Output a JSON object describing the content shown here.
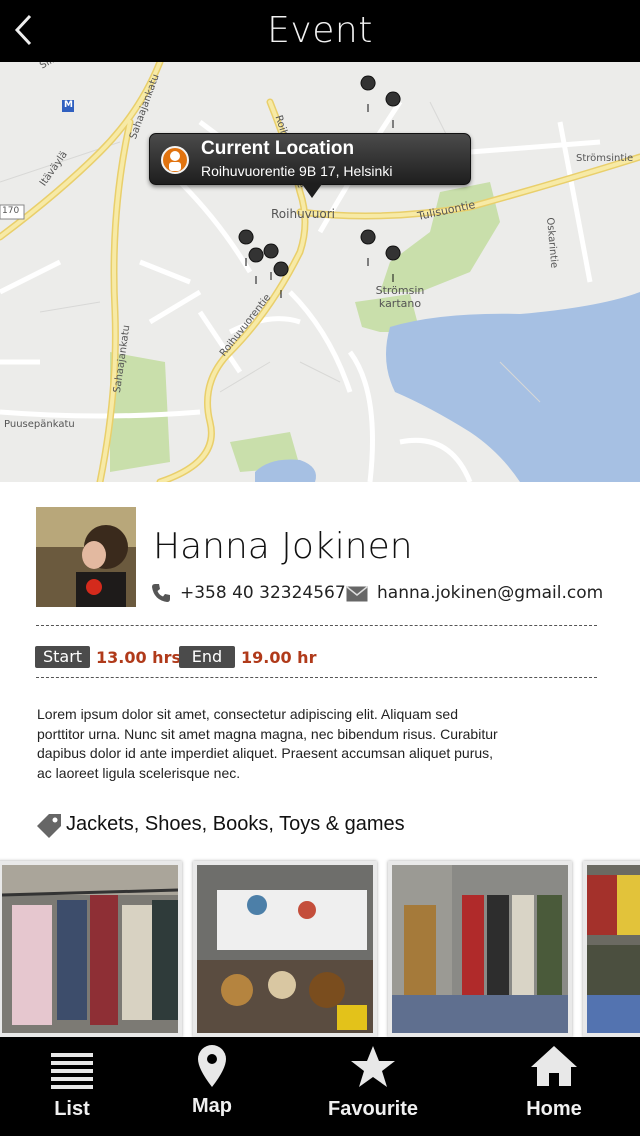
{
  "header": {
    "title": "Event",
    "back_icon": "chevron-left-icon"
  },
  "map": {
    "callout": {
      "title": "Current Location",
      "address": "Roihuvuorentie 9B 17, Helsinki",
      "icon": "person-icon"
    },
    "street_labels": [
      "Sahaajankatu",
      "Itäväylä",
      "Roihuvuorentie",
      "Roihuvuori",
      "Tulisuontie",
      "Strömsintie",
      "Oskarintie",
      "Strömsin kartano",
      "Puusepänkatu",
      "Sahaajankatu",
      "Roihuvuorentie",
      "Sillitie",
      "170",
      "M"
    ]
  },
  "profile": {
    "name": "Hanna Jokinen",
    "phone": "+358 40 32324567",
    "email": "hanna.jokinen@gmail.com"
  },
  "times": {
    "start_label": "Start",
    "start_value": "13.00 hrs",
    "end_label": "End",
    "end_value": "19.00 hr"
  },
  "description": "Lorem ipsum dolor sit amet, consectetur adipiscing elit. Aliquam sed porttitor urna. Nunc sit amet magna magna, nec bibendum risus. Curabitur dapibus dolor id ante imperdiet aliquet. Praesent accumsan aliquet purus, ac laoreet ligula scelerisque nec.",
  "categories": "Jackets, Shoes, Books, Toys & games",
  "tabs": [
    {
      "label": "List",
      "icon": "list-icon"
    },
    {
      "label": "Map",
      "icon": "map-pin-icon"
    },
    {
      "label": "Favourite",
      "icon": "star-icon"
    },
    {
      "label": "Home",
      "icon": "home-icon"
    }
  ],
  "colors": {
    "time_accent": "#b03a1a",
    "header_bg": "#000000",
    "tag_bg": "#4b4b4b"
  }
}
